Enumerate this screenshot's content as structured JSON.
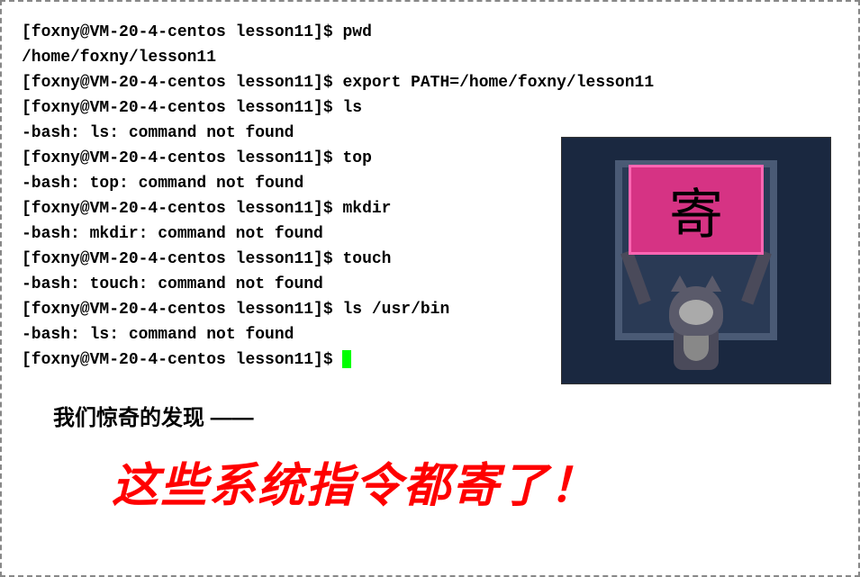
{
  "terminal": {
    "prompt": "[foxny@VM-20-4-centos lesson11]$ ",
    "lines": [
      {
        "prompt": true,
        "cmd": "pwd"
      },
      {
        "prompt": false,
        "text": "/home/foxny/lesson11"
      },
      {
        "prompt": true,
        "cmd": "export PATH=/home/foxny/lesson11"
      },
      {
        "prompt": true,
        "cmd": "ls"
      },
      {
        "prompt": false,
        "text": "-bash: ls: command not found"
      },
      {
        "prompt": true,
        "cmd": "top"
      },
      {
        "prompt": false,
        "text": "-bash: top: command not found"
      },
      {
        "prompt": true,
        "cmd": "mkdir"
      },
      {
        "prompt": false,
        "text": "-bash: mkdir: command not found"
      },
      {
        "prompt": true,
        "cmd": "touch"
      },
      {
        "prompt": false,
        "text": "-bash: touch: command not found"
      },
      {
        "prompt": true,
        "cmd": "ls /usr/bin"
      },
      {
        "prompt": false,
        "text": "-bash: ls: command not found"
      },
      {
        "prompt": true,
        "cmd": "",
        "cursor": true
      }
    ]
  },
  "meme": {
    "sign_text": "寄"
  },
  "commentary": {
    "line1": "我们惊奇的发现 ——",
    "line2": "这些系统指令都寄了！"
  }
}
